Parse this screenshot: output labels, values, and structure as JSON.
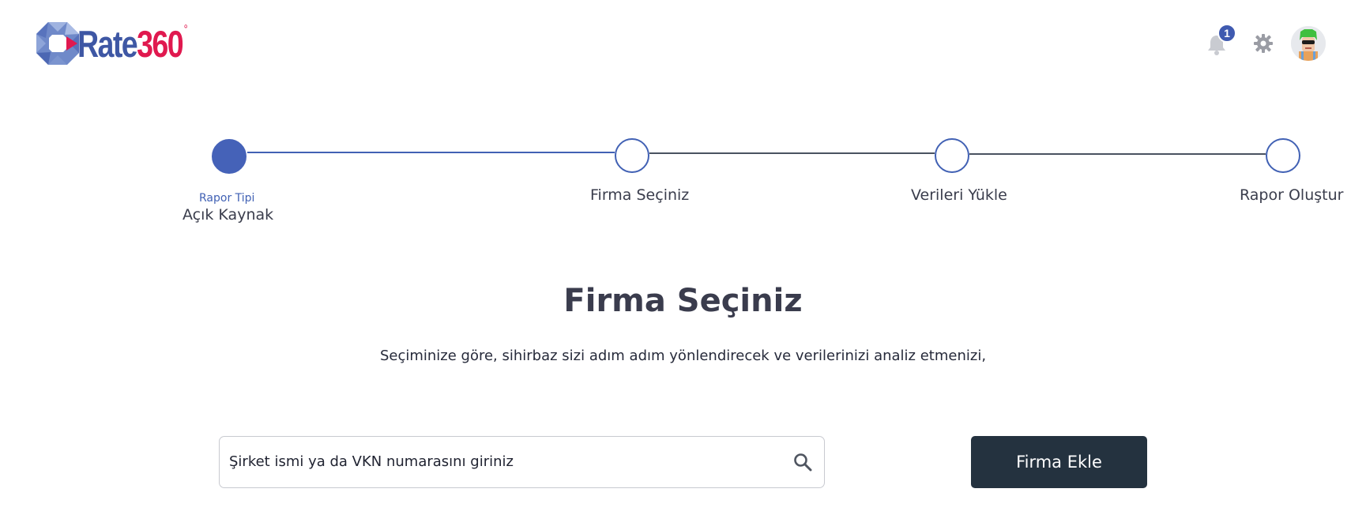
{
  "app": {
    "logo_text": "Rate",
    "logo_number": "360",
    "logo_degree": "°"
  },
  "header": {
    "notification_count": "1",
    "icons": [
      "bell-icon",
      "gear-icon",
      "avatar"
    ]
  },
  "stepper": {
    "steps": [
      {
        "sublabel": "Rapor Tipi",
        "label": "Açık Kaynak",
        "state": "completed"
      },
      {
        "label": "Firma Seçiniz",
        "state": "pending"
      },
      {
        "label": "Verileri  Yükle",
        "state": "pending"
      },
      {
        "label": "Rapor Oluştur",
        "state": "pending"
      }
    ]
  },
  "main": {
    "title": "Firma Seçiniz",
    "subtitle": "Seçiminize göre, sihirbaz sizi adım adım yönlendirecek ve verilerinizi analiz etmenizi,",
    "search": {
      "placeholder": "Şirket ismi ya da VKN numarasını giriniz",
      "value": ""
    },
    "add_button_label": "Firma Ekle"
  },
  "colors": {
    "brand_blue": "#3e57a4",
    "brand_red": "#e0194f",
    "step_blue": "#4562b8",
    "button_dark": "#24323f"
  }
}
